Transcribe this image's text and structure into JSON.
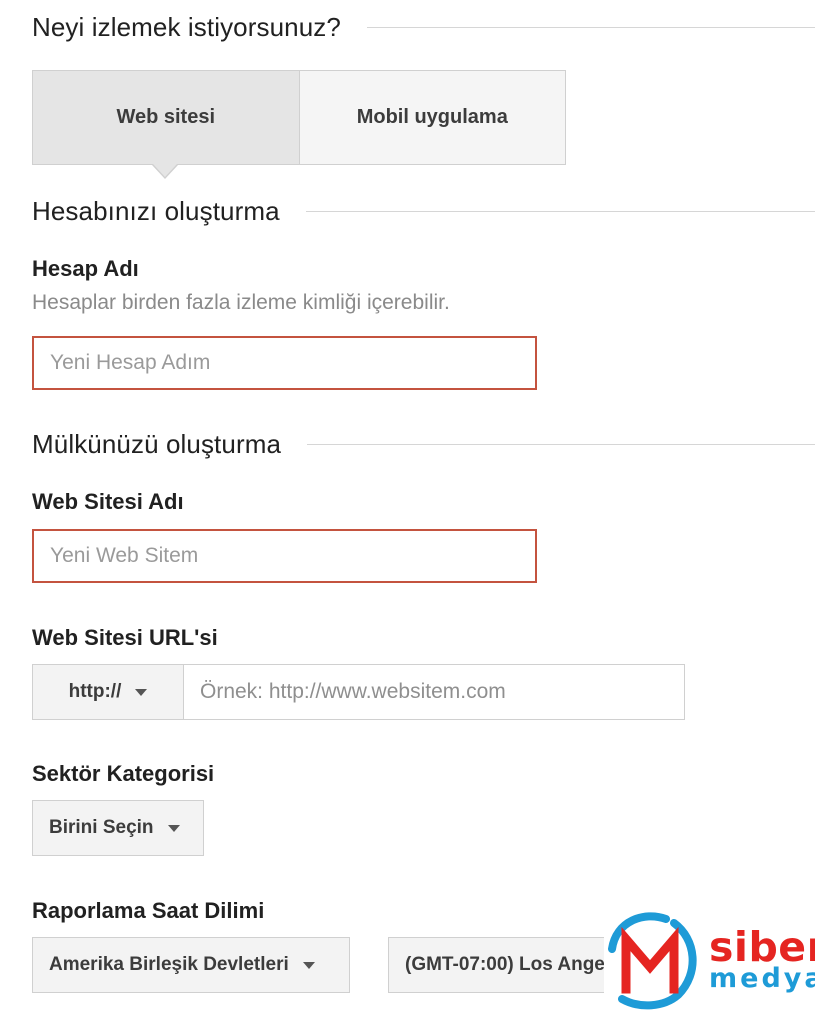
{
  "track": {
    "title": "Neyi izlemek istiyorsunuz?",
    "options": [
      "Web sitesi",
      "Mobil uygulama"
    ],
    "selected": "Web sitesi"
  },
  "account": {
    "title": "Hesabınızı oluşturma",
    "name_label": "Hesap Adı",
    "name_help": "Hesaplar birden fazla izleme kimliği içerebilir.",
    "name_placeholder": "Yeni Hesap Adım"
  },
  "property": {
    "title": "Mülkünüzü oluşturma",
    "site_name_label": "Web Sitesi Adı",
    "site_name_placeholder": "Yeni Web Sitem",
    "url_label": "Web Sitesi URL'si",
    "url_protocol": "http://",
    "url_placeholder": "Örnek: http://www.websitem.com",
    "category_label": "Sektör Kategorisi",
    "category_value": "Birini Seçin",
    "timezone_label": "Raporlama Saat Dilimi",
    "timezone_country": "Amerika Birleşik Devletleri",
    "timezone_zone": "(GMT-07:00) Los Angeles"
  },
  "logo": {
    "word1": "siber",
    "word2": "medya",
    "colors": {
      "red": "#e52521",
      "blue": "#1e9bd7"
    },
    "icon": "siber-medya-logo-icon"
  },
  "colors": {
    "input_error_border": "#c4533f",
    "button_bg": "#f3f3f3",
    "selected_tab_bg": "#e5e5e5"
  }
}
